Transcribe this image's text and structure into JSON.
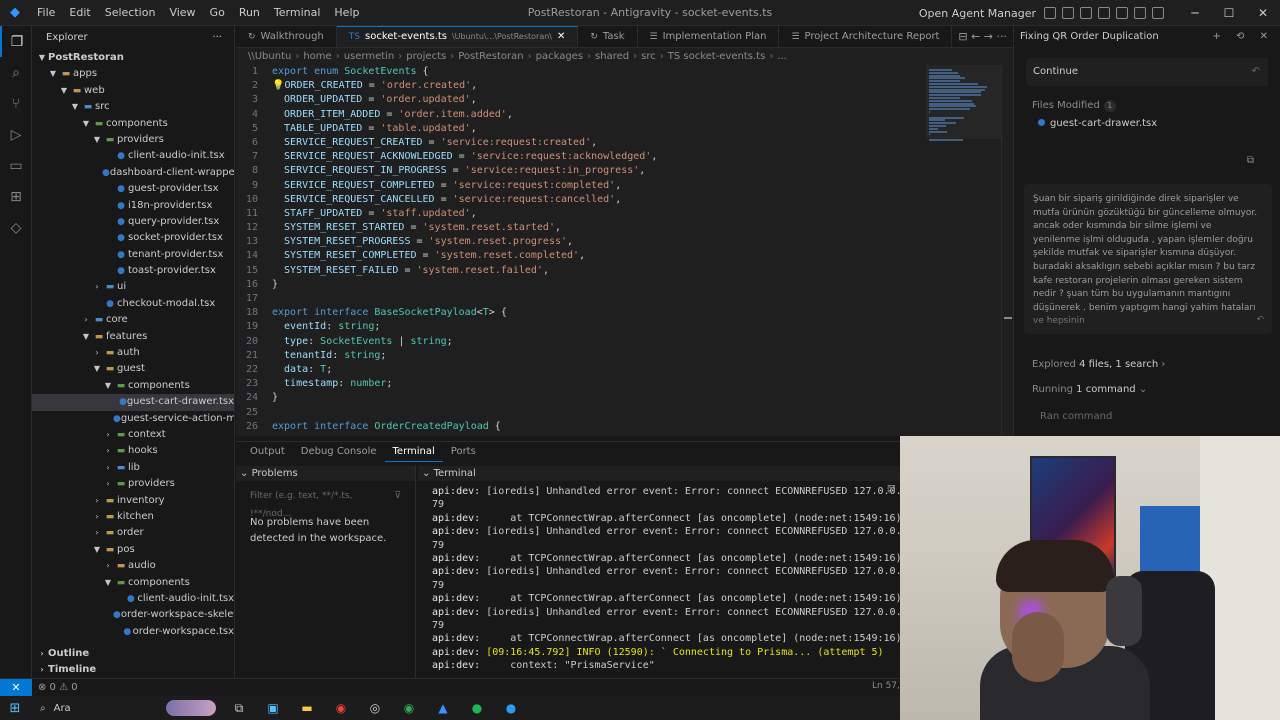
{
  "window": {
    "title": "PostRestoran - Antigravity - socket-events.ts",
    "agent_manager": "Open Agent Manager",
    "min": "─",
    "max": "☐",
    "close": "✕"
  },
  "menu": [
    "File",
    "Edit",
    "Selection",
    "View",
    "Go",
    "Run",
    "Terminal",
    "Help"
  ],
  "explorer": {
    "title": "Explorer",
    "more": "···",
    "root": "PostRestoran",
    "tree": [
      {
        "depth": 1,
        "open": true,
        "folder": true,
        "label": "apps"
      },
      {
        "depth": 2,
        "open": true,
        "folder": true,
        "label": "web"
      },
      {
        "depth": 3,
        "open": true,
        "folder": true,
        "label": "src"
      },
      {
        "depth": 4,
        "open": true,
        "folder": true,
        "label": "components"
      },
      {
        "depth": 5,
        "open": true,
        "folder": true,
        "label": "providers"
      },
      {
        "depth": 6,
        "label": "client-audio-init.tsx"
      },
      {
        "depth": 6,
        "label": "dashboard-client-wrapper.tsx"
      },
      {
        "depth": 6,
        "label": "guest-provider.tsx"
      },
      {
        "depth": 6,
        "label": "i18n-provider.tsx"
      },
      {
        "depth": 6,
        "label": "query-provider.tsx"
      },
      {
        "depth": 6,
        "label": "socket-provider.tsx"
      },
      {
        "depth": 6,
        "label": "tenant-provider.tsx"
      },
      {
        "depth": 6,
        "label": "toast-provider.tsx"
      },
      {
        "depth": 5,
        "open": false,
        "folder": true,
        "label": "ui"
      },
      {
        "depth": 5,
        "label": "checkout-modal.tsx"
      },
      {
        "depth": 4,
        "open": false,
        "folder": true,
        "label": "core"
      },
      {
        "depth": 4,
        "open": true,
        "folder": true,
        "label": "features"
      },
      {
        "depth": 5,
        "open": false,
        "folder": true,
        "label": "auth"
      },
      {
        "depth": 5,
        "open": true,
        "folder": true,
        "label": "guest"
      },
      {
        "depth": 6,
        "open": true,
        "folder": true,
        "label": "components"
      },
      {
        "depth": 7,
        "label": "guest-cart-drawer.tsx",
        "selected": true
      },
      {
        "depth": 7,
        "label": "guest-service-action-menu.t..."
      },
      {
        "depth": 6,
        "open": false,
        "folder": true,
        "label": "context"
      },
      {
        "depth": 6,
        "open": false,
        "folder": true,
        "label": "hooks"
      },
      {
        "depth": 6,
        "open": false,
        "folder": true,
        "label": "lib"
      },
      {
        "depth": 6,
        "open": false,
        "folder": true,
        "label": "providers"
      },
      {
        "depth": 5,
        "open": false,
        "folder": true,
        "label": "inventory"
      },
      {
        "depth": 5,
        "open": false,
        "folder": true,
        "label": "kitchen"
      },
      {
        "depth": 5,
        "open": false,
        "folder": true,
        "label": "order"
      },
      {
        "depth": 5,
        "open": true,
        "folder": true,
        "label": "pos"
      },
      {
        "depth": 6,
        "open": false,
        "folder": true,
        "label": "audio"
      },
      {
        "depth": 6,
        "open": true,
        "folder": true,
        "label": "components"
      },
      {
        "depth": 7,
        "label": "client-audio-init.tsx"
      },
      {
        "depth": 7,
        "label": "order-workspace-skeleton.tsx"
      },
      {
        "depth": 7,
        "label": "order-workspace.tsx"
      }
    ],
    "outline": "Outline",
    "timeline": "Timeline"
  },
  "tabs": [
    {
      "label": "Walkthrough",
      "icon": "↻",
      "active": false
    },
    {
      "label": "socket-events.ts",
      "hint": "\\Ubuntu\\...\\PostRestoran\\",
      "icon": "TS",
      "active": true
    },
    {
      "label": "Task",
      "icon": "↻",
      "active": false
    },
    {
      "label": "Implementation Plan",
      "icon": "☰",
      "active": false
    },
    {
      "label": "Project Architecture Report",
      "icon": "☰",
      "active": false
    }
  ],
  "tab_tools": "⊟ ← → ···",
  "breadcrumb": [
    "\\\\Ubuntu",
    "home",
    "usermetin",
    "projects",
    "PostRestoran",
    "packages",
    "shared",
    "src",
    "TS socket-events.ts",
    "..."
  ],
  "code_lines": [
    {
      "n": "1",
      "toks": [
        [
          "kw",
          "export "
        ],
        [
          "kw",
          "enum "
        ],
        [
          "ty",
          "SocketEvents "
        ],
        [
          "pu",
          "{"
        ]
      ]
    },
    {
      "n": "2",
      "bulb": true,
      "toks": [
        [
          "vr",
          "ORDER_CREATED"
        ],
        [
          "pu",
          " = "
        ],
        [
          "st",
          "'order.created'"
        ],
        [
          "pu",
          ","
        ]
      ]
    },
    {
      "n": "3",
      "toks": [
        [
          "vr",
          "  ORDER_UPDATED"
        ],
        [
          "pu",
          " = "
        ],
        [
          "st",
          "'order.updated'"
        ],
        [
          "pu",
          ","
        ]
      ]
    },
    {
      "n": "4",
      "toks": [
        [
          "vr",
          "  ORDER_ITEM_ADDED"
        ],
        [
          "pu",
          " = "
        ],
        [
          "st",
          "'order.item.added'"
        ],
        [
          "pu",
          ","
        ]
      ]
    },
    {
      "n": "5",
      "toks": [
        [
          "vr",
          "  TABLE_UPDATED"
        ],
        [
          "pu",
          " = "
        ],
        [
          "st",
          "'table.updated'"
        ],
        [
          "pu",
          ","
        ]
      ]
    },
    {
      "n": "6",
      "toks": [
        [
          "vr",
          "  SERVICE_REQUEST_CREATED"
        ],
        [
          "pu",
          " = "
        ],
        [
          "st",
          "'service:request:created'"
        ],
        [
          "pu",
          ","
        ]
      ]
    },
    {
      "n": "7",
      "toks": [
        [
          "vr",
          "  SERVICE_REQUEST_ACKNOWLEDGED"
        ],
        [
          "pu",
          " = "
        ],
        [
          "st",
          "'service:request:acknowledged'"
        ],
        [
          "pu",
          ","
        ]
      ]
    },
    {
      "n": "8",
      "toks": [
        [
          "vr",
          "  SERVICE_REQUEST_IN_PROGRESS"
        ],
        [
          "pu",
          " = "
        ],
        [
          "st",
          "'service:request:in_progress'"
        ],
        [
          "pu",
          ","
        ]
      ]
    },
    {
      "n": "9",
      "toks": [
        [
          "vr",
          "  SERVICE_REQUEST_COMPLETED"
        ],
        [
          "pu",
          " = "
        ],
        [
          "st",
          "'service:request:completed'"
        ],
        [
          "pu",
          ","
        ]
      ]
    },
    {
      "n": "10",
      "toks": [
        [
          "vr",
          "  SERVICE_REQUEST_CANCELLED"
        ],
        [
          "pu",
          " = "
        ],
        [
          "st",
          "'service:request:cancelled'"
        ],
        [
          "pu",
          ","
        ]
      ]
    },
    {
      "n": "11",
      "toks": [
        [
          "vr",
          "  STAFF_UPDATED"
        ],
        [
          "pu",
          " = "
        ],
        [
          "st",
          "'staff.updated'"
        ],
        [
          "pu",
          ","
        ]
      ]
    },
    {
      "n": "12",
      "toks": [
        [
          "vr",
          "  SYSTEM_RESET_STARTED"
        ],
        [
          "pu",
          " = "
        ],
        [
          "st",
          "'system.reset.started'"
        ],
        [
          "pu",
          ","
        ]
      ]
    },
    {
      "n": "13",
      "toks": [
        [
          "vr",
          "  SYSTEM_RESET_PROGRESS"
        ],
        [
          "pu",
          " = "
        ],
        [
          "st",
          "'system.reset.progress'"
        ],
        [
          "pu",
          ","
        ]
      ]
    },
    {
      "n": "14",
      "toks": [
        [
          "vr",
          "  SYSTEM_RESET_COMPLETED"
        ],
        [
          "pu",
          " = "
        ],
        [
          "st",
          "'system.reset.completed'"
        ],
        [
          "pu",
          ","
        ]
      ]
    },
    {
      "n": "15",
      "toks": [
        [
          "vr",
          "  SYSTEM_RESET_FAILED"
        ],
        [
          "pu",
          " = "
        ],
        [
          "st",
          "'system.reset.failed'"
        ],
        [
          "pu",
          ","
        ]
      ]
    },
    {
      "n": "16",
      "toks": [
        [
          "pu",
          "}"
        ]
      ]
    },
    {
      "n": "17",
      "toks": []
    },
    {
      "n": "18",
      "toks": [
        [
          "kw",
          "export "
        ],
        [
          "kw",
          "interface "
        ],
        [
          "ty",
          "BaseSocketPayload"
        ],
        [
          "pu",
          "<"
        ],
        [
          "ty",
          "T"
        ],
        [
          "pu",
          "> {"
        ]
      ]
    },
    {
      "n": "19",
      "toks": [
        [
          "vr",
          "  eventId"
        ],
        [
          "pu",
          ": "
        ],
        [
          "ty",
          "string"
        ],
        [
          "pu",
          ";"
        ]
      ]
    },
    {
      "n": "20",
      "toks": [
        [
          "vr",
          "  type"
        ],
        [
          "pu",
          ": "
        ],
        [
          "ty",
          "SocketEvents "
        ],
        [
          "pu",
          "| "
        ],
        [
          "ty",
          "string"
        ],
        [
          "pu",
          ";"
        ]
      ]
    },
    {
      "n": "21",
      "toks": [
        [
          "vr",
          "  tenantId"
        ],
        [
          "pu",
          ": "
        ],
        [
          "ty",
          "string"
        ],
        [
          "pu",
          ";"
        ]
      ]
    },
    {
      "n": "22",
      "toks": [
        [
          "vr",
          "  data"
        ],
        [
          "pu",
          ": "
        ],
        [
          "ty",
          "T"
        ],
        [
          "pu",
          ";"
        ]
      ]
    },
    {
      "n": "23",
      "toks": [
        [
          "vr",
          "  timestamp"
        ],
        [
          "pu",
          ": "
        ],
        [
          "ty",
          "number"
        ],
        [
          "pu",
          ";"
        ]
      ]
    },
    {
      "n": "24",
      "toks": [
        [
          "pu",
          "}"
        ]
      ]
    },
    {
      "n": "25",
      "toks": []
    },
    {
      "n": "26",
      "toks": [
        [
          "kw",
          "export "
        ],
        [
          "kw",
          "interface "
        ],
        [
          "ty",
          "OrderCreatedPayload "
        ],
        [
          "pu",
          "{"
        ]
      ]
    }
  ],
  "panel": {
    "tabs": [
      "Output",
      "Debug Console",
      "Terminal",
      "Ports"
    ],
    "active_tab": "Terminal",
    "problems_title": "Problems",
    "filter_placeholder": "Filter (e.g. text, **/*.ts, !**/nod...",
    "no_problems": "No problems have been detected in the workspace.",
    "terminal_title": "Terminal",
    "terminal_lines": [
      [
        "api:dev: ",
        "[ioredis] Unhandled error event: Error: connect ECONNREFUSED 127.0.0.1:63"
      ],
      [
        "",
        "79"
      ],
      [
        "api:dev: ",
        "    at TCPConnectWrap.afterConnect [as oncomplete] (node:net:1549:16)"
      ],
      [
        "api:dev: ",
        "[ioredis] Unhandled error event: Error: connect ECONNREFUSED 127.0.0.1:63"
      ],
      [
        "",
        "79"
      ],
      [
        "api:dev: ",
        "    at TCPConnectWrap.afterConnect [as oncomplete] (node:net:1549:16)"
      ],
      [
        "api:dev: ",
        "[ioredis] Unhandled error event: Error: connect ECONNREFUSED 127.0.0.1:63"
      ],
      [
        "",
        "79"
      ],
      [
        "api:dev: ",
        "    at TCPConnectWrap.afterConnect [as oncomplete] (node:net:1549:16)"
      ],
      [
        "api:dev: ",
        "[ioredis] Unhandled error event: Error: connect ECONNREFUSED 127.0.0.1:63"
      ],
      [
        "",
        "79"
      ],
      [
        "api:dev: ",
        "    at TCPConnectWrap.afterConnect [as oncomplete] (node:net:1549:16)"
      ],
      [
        "api:dev: ",
        "[09:16:45.792] INFO (12590): ` Connecting to Prisma... (attempt 5)"
      ],
      [
        "api:dev: ",
        "    context: \"PrismaService\""
      ]
    ]
  },
  "status": {
    "remote": "✕",
    "errors": "⊗ 0 ⚠ 0",
    "position": "Ln 57,"
  },
  "agent": {
    "title": "Fixing QR Order Duplication",
    "continue": "Continue",
    "files_modified": "Files Modified",
    "files_count": "1",
    "file": "guest-cart-drawer.tsx",
    "message": "Şuan bir sipariş girildiğinde direk  siparişler ve mutfa  ürünün gözüktüğü bir güncelleme olmuyor. ancak   oder kısmında bir  silme işlemi ve yenilenme işlmi olduguda  ,  yapan işlemler doğru şekilde  mutfak  ve siparişler kısmına düşüyor. buradaki aksaklıgın sebebi açıklar mısın ?  bu tarz  kafe restoran projelerin olması gereken sistem nedir ?   şuan tüm bu uygulamanın mantıgını düşünerek . benim yaptıgım hangi yahim hataları ve hepsinin",
    "explored_prefix": "Explored",
    "explored_value": "4 files, 1 search",
    "running_prefix": "Running",
    "running_value": "1 command",
    "ran_command": "Ran command"
  },
  "taskbar": {
    "search": "Ara"
  }
}
